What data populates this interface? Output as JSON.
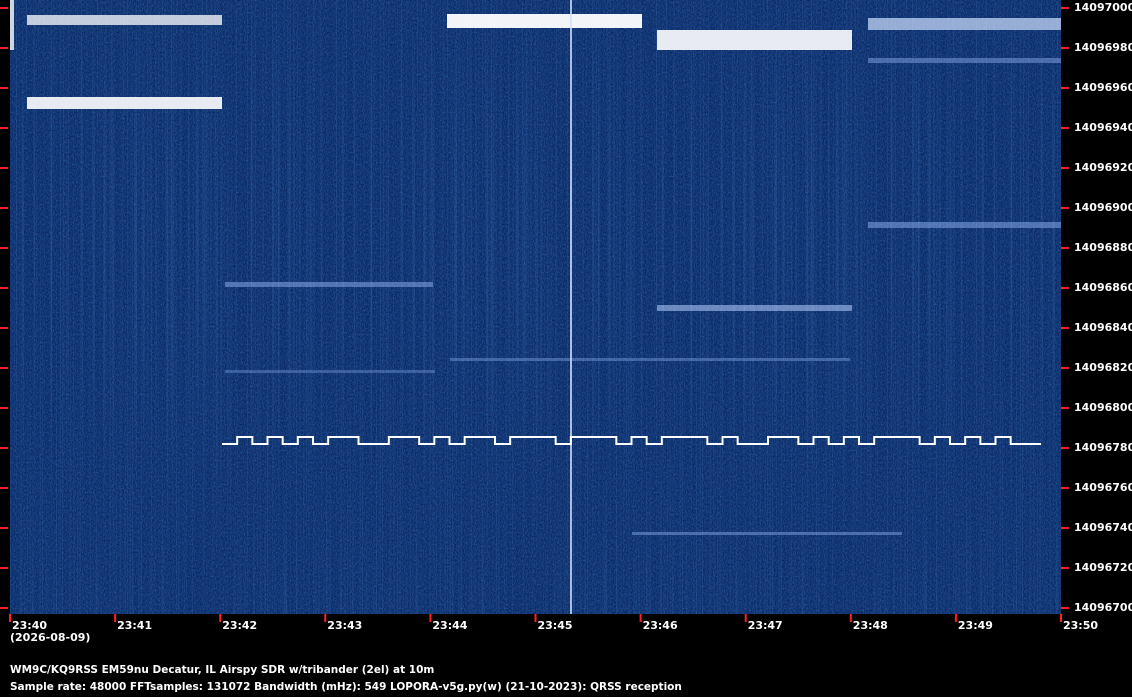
{
  "chart_data": {
    "type": "heatmap",
    "y_ticks": [
      "14097000",
      "14096980",
      "14096960",
      "14096940",
      "14096920",
      "14096900",
      "14096880",
      "14096860",
      "14096840",
      "14096820",
      "14096800",
      "14096780",
      "14096760",
      "14096740",
      "14096720",
      "14096700"
    ],
    "x_ticks": [
      "23:40",
      "23:41",
      "23:42",
      "23:43",
      "23:44",
      "23:45",
      "23:46",
      "23:47",
      "23:48",
      "23:49",
      "23:50"
    ],
    "date": "(2026-08-09)",
    "ylim": [
      14096700,
      14097000
    ],
    "xlim": [
      "23:40",
      "23:50"
    ],
    "fsk_signal_center": 14096781,
    "colors": {
      "background": "#0a2a66",
      "signal": "#ffffff",
      "tick": "#ff2020"
    }
  },
  "info": {
    "line1": "WM9C/KQ9RSS EM59nu Decatur, IL  Airspy SDR w/tribander (2el) at 10m",
    "line2": "Sample rate: 48000    FFTsamples: 131072    Bandwidth (mHz): 549         LOPORA-v5g.py(w) (21-10-2023): QRSS reception"
  }
}
